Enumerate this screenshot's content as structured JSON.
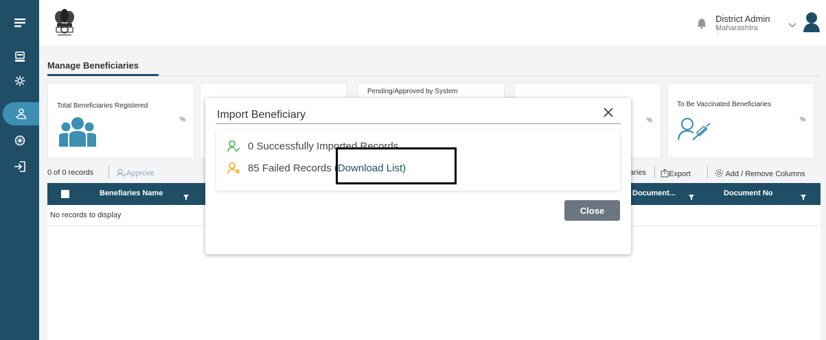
{
  "header": {
    "user_name": "District Admin",
    "user_state": "Maharashtra"
  },
  "page": {
    "tab_label": "Manage Beneficiaries"
  },
  "cards": {
    "total": {
      "title": "Total Beneficiaries Registered",
      "percent": "%"
    },
    "pending": {
      "title": "Pending/Approved by System"
    },
    "hidden": {
      "percent": "%"
    },
    "to_vaccinate": {
      "title": "To Be Vaccinated Beneficiaries",
      "percent": "%"
    }
  },
  "toolbar": {
    "record_count": "0 of 0 records",
    "approve_label": "Approve",
    "beneficiaries_fragment": "aries",
    "export_label": "Export",
    "columns_label": "Add / Remove Columns"
  },
  "table": {
    "columns": [
      "Benefiaries Name",
      "Document...",
      "Document No"
    ],
    "empty_message": "No records to display"
  },
  "modal": {
    "title": "Import Beneficiary",
    "success_text": "0 Successfully Imported Records",
    "failed_text": "85 Failed Records ",
    "download_label": "(Download List)",
    "close_button": "Close"
  },
  "colors": {
    "sidebar": "#1f4e66",
    "sidebar_active": "#3d8fb4",
    "success": "#4caf50",
    "failed": "#f5a623",
    "close_button": "#6b7680"
  },
  "icons": {
    "sidebar": [
      "menu-icon",
      "dashboard-icon",
      "vaccine-icon",
      "beneficiary-icon",
      "settings-icon",
      "logout-icon"
    ],
    "header": [
      "emblem-logo",
      "bell-icon",
      "chevron-down-icon",
      "avatar-icon"
    ]
  }
}
